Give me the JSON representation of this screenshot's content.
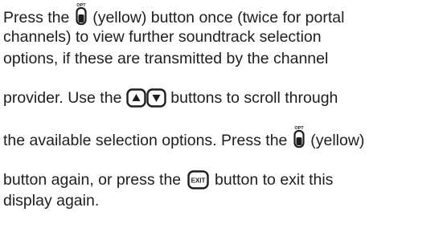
{
  "paragraph": {
    "l1_before": "Press the",
    "l1_after": "(yellow) button once (twice for portal",
    "l2": "channels) to view further soundtrack selection",
    "l3": "options, if these are transmitted by the channel",
    "l4_before": "provider. Use the",
    "l4_after": "buttons to scroll through",
    "l5_before": "the available selection options. Press the",
    "l5_after": "(yellow)",
    "l6_before": "button again, or press the",
    "l6_after": "button to exit this",
    "l7": "display again."
  },
  "icons": {
    "opt_label": "OPT",
    "exit_label": "EXIT",
    "opt_button": "opt-yellow-button-icon",
    "up_button": "up-arrow-button-icon",
    "down_button": "down-arrow-button-icon",
    "exit_button": "exit-button-icon"
  }
}
